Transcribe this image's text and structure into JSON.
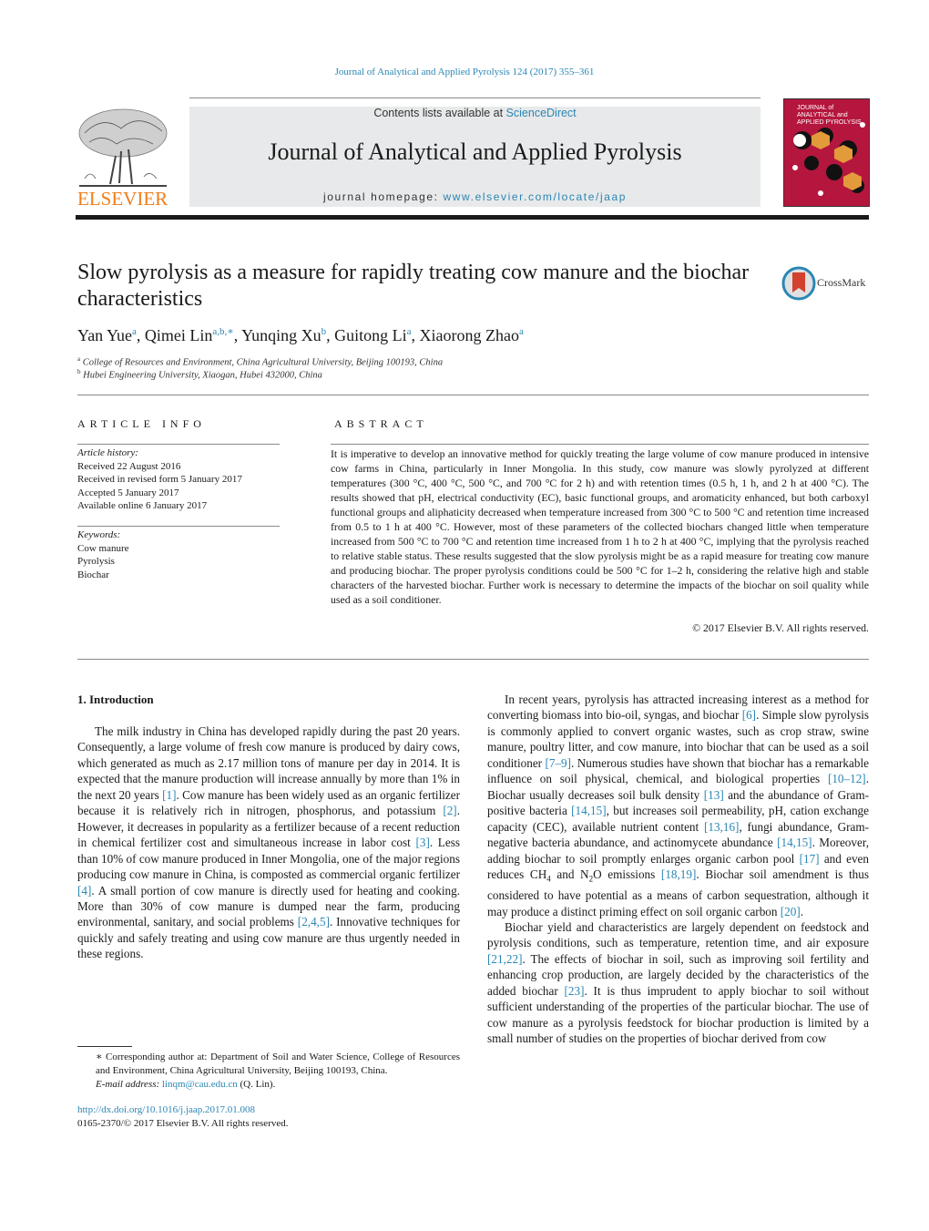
{
  "header": {
    "journal_reference": "Journal of Analytical and Applied Pyrolysis 124 (2017) 355–361",
    "contents_prefix": "Contents lists available at ",
    "contents_link": "ScienceDirect",
    "journal_title": "Journal of Analytical and Applied Pyrolysis",
    "homepage_prefix": "journal homepage: ",
    "homepage_link": "www.elsevier.com/locate/jaap",
    "publisher_logo": "ELSEVIER",
    "cover_title_lines": [
      "JOURNAL of",
      "ANALYTICAL and",
      "APPLIED PYROLYSIS"
    ],
    "crossmark_label": "CrossMark",
    "colors": {
      "link": "#2a86b4",
      "elsevier_orange": "#ef7d1a",
      "cover_bg": "#b5163e",
      "header_box": "#e8e9ea"
    }
  },
  "article": {
    "title": "Slow pyrolysis as a measure for rapidly treating cow manure and the biochar characteristics",
    "authors": [
      {
        "name": "Yan Yue",
        "sup": "a"
      },
      {
        "name": "Qimei Lin",
        "sup": "a,b,∗"
      },
      {
        "name": "Yunqing Xu",
        "sup": "b"
      },
      {
        "name": "Guitong Li",
        "sup": "a"
      },
      {
        "name": "Xiaorong Zhao",
        "sup": "a"
      }
    ],
    "affiliations": [
      {
        "sup": "a",
        "text": "College of Resources and Environment, China Agricultural University, Beijing 100193, China"
      },
      {
        "sup": "b",
        "text": "Hubei Engineering University, Xiaogan, Hubei 432000, China"
      }
    ]
  },
  "article_info": {
    "heading": "ARTICLE INFO",
    "history_label": "Article history:",
    "history": [
      "Received 22 August 2016",
      "Received in revised form 5 January 2017",
      "Accepted 5 January 2017",
      "Available online 6 January 2017"
    ],
    "keywords_label": "Keywords:",
    "keywords": [
      "Cow manure",
      "Pyrolysis",
      "Biochar"
    ]
  },
  "abstract": {
    "heading": "ABSTRACT",
    "text": "It is imperative to develop an innovative method for quickly treating the large volume of cow manure produced in intensive cow farms in China, particularly in Inner Mongolia. In this study, cow manure was slowly pyrolyzed at different temperatures (300 °C, 400 °C, 500 °C, and 700 °C for 2 h) and with retention times (0.5 h, 1 h, and 2 h at 400 °C). The results showed that pH, electrical conductivity (EC), basic functional groups, and aromaticity enhanced, but both carboxyl functional groups and aliphaticity decreased when temperature increased from 300 °C to 500 °C and retention time increased from 0.5 to 1 h at 400 °C. However, most of these parameters of the collected biochars changed little when temperature increased from 500 °C to 700 °C and retention time increased from 1 h to 2 h at 400 °C, implying that the pyrolysis reached to relative stable status. These results suggested that the slow pyrolysis might be as a rapid measure for treating cow manure and producing biochar. The proper pyrolysis conditions could be 500 °C for 1–2 h, considering the relative high and stable characters of the harvested biochar. Further work is necessary to determine the impacts of the biochar on soil quality while used as a soil conditioner.",
    "copyright": "© 2017 Elsevier B.V. All rights reserved."
  },
  "introduction": {
    "heading": "1.  Introduction",
    "left_paragraph": [
      {
        "t": "The milk industry in China has developed rapidly during the past 20 years. Consequently, a large volume of fresh cow manure is produced by dairy cows, which generated as much as 2.17 million tons of manure per day in 2014. It is expected that the manure production will increase annually by more than 1% in the next 20 years "
      },
      {
        "ref": "[1]"
      },
      {
        "t": ". Cow manure has been widely used as an organic fertilizer because it is relatively rich in nitrogen, phosphorus, and potassium "
      },
      {
        "ref": "[2]"
      },
      {
        "t": ". However, it decreases in popularity as a fertilizer because of a recent reduction in chemical fertilizer cost and simultaneous increase in labor cost "
      },
      {
        "ref": "[3]"
      },
      {
        "t": ". Less than 10% of cow manure produced in Inner Mongolia, one of the major regions producing cow manure in China, is composted as commercial organic fertilizer "
      },
      {
        "ref": "[4]"
      },
      {
        "t": ". A small portion of cow manure is directly used for heating and cooking. More than 30% of cow manure is dumped near the farm, producing environmental, sanitary, and social problems "
      },
      {
        "ref": "[2,4,5]"
      },
      {
        "t": ". Innovative techniques for quickly and safely treating and using cow manure are thus urgently needed in these regions."
      }
    ],
    "right_paragraph_1": [
      {
        "t": "In recent years, pyrolysis has attracted increasing interest as a method for converting biomass into bio-oil, syngas, and biochar "
      },
      {
        "ref": "[6]"
      },
      {
        "t": ". Simple slow pyrolysis is commonly applied to convert organic wastes, such as crop straw, swine manure, poultry litter, and cow manure, into biochar that can be used as a soil conditioner "
      },
      {
        "ref": "[7–9]"
      },
      {
        "t": ". Numerous studies have shown that biochar has a remarkable influence on soil physical, chemical, and biological properties "
      },
      {
        "ref": "[10–12]"
      },
      {
        "t": ". Biochar usually decreases soil bulk density "
      },
      {
        "ref": "[13]"
      },
      {
        "t": " and the abundance of Gram-positive bacteria "
      },
      {
        "ref": "[14,15]"
      },
      {
        "t": ", but increases soil permeability, pH, cation exchange capacity (CEC), available nutrient content "
      },
      {
        "ref": "[13,16]"
      },
      {
        "t": ", fungi abundance, Gram-negative bacteria abundance, and actinomycete abundance "
      },
      {
        "ref": "[14,15]"
      },
      {
        "t": ". Moreover, adding biochar to soil promptly enlarges organic carbon pool "
      },
      {
        "ref": "[17]"
      },
      {
        "t": " and even reduces CH"
      },
      {
        "sub": "4"
      },
      {
        "t": " and N"
      },
      {
        "sub": "2"
      },
      {
        "t": "O emissions "
      },
      {
        "ref": "[18,19]"
      },
      {
        "t": ". Biochar soil amendment is thus considered to have potential as a means of carbon sequestration, although it may produce a distinct priming effect on soil organic carbon "
      },
      {
        "ref": "[20]"
      },
      {
        "t": "."
      }
    ],
    "right_paragraph_2": [
      {
        "t": "Biochar yield and characteristics are largely dependent on feedstock and pyrolysis conditions, such as temperature, retention time, and air exposure "
      },
      {
        "ref": "[21,22]"
      },
      {
        "t": ". The effects of biochar in soil, such as improving soil fertility and enhancing crop production, are largely decided by the characteristics of the added biochar "
      },
      {
        "ref": "[23]"
      },
      {
        "t": ". It is thus imprudent to apply biochar to soil without sufficient understanding of the properties of the particular biochar. The use of cow manure as a pyrolysis feedstock for biochar production is limited by a small number of studies on the properties of biochar derived from cow"
      }
    ]
  },
  "footnote": {
    "corresponding": "∗  Corresponding author at: Department of Soil and Water Science, College of Resources and Environment, China Agricultural University, Beijing 100193, China.",
    "email_label": "E-mail address: ",
    "email": "linqm@cau.edu.cn",
    "email_suffix": " (Q. Lin).",
    "doi": "http://dx.doi.org/10.1016/j.jaap.2017.01.008",
    "issn_line": "0165-2370/© 2017 Elsevier B.V. All rights reserved."
  }
}
